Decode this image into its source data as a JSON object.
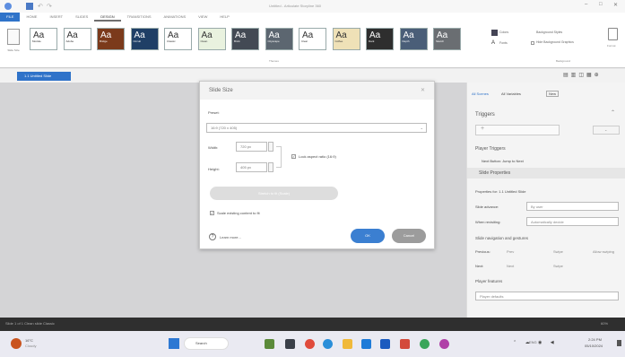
{
  "titlebar": {
    "title": "Untitled - Articulate Storyline 360",
    "close": "✕",
    "minimize": "–",
    "maximize": "□"
  },
  "ribbon": {
    "tabs": [
      "FILE",
      "HOME",
      "INSERT",
      "SLIDES",
      "DESIGN",
      "TRANSITIONS",
      "ANIMATIONS",
      "VIEW",
      "HELP"
    ],
    "themes": [
      {
        "aa": "Aa",
        "label": "Module",
        "bg": "#ffffff",
        "fg": "#333333"
      },
      {
        "aa": "Aa",
        "label": "Adobe",
        "bg": "#ffffff",
        "fg": "#333333"
      },
      {
        "aa": "Aa",
        "label": "Bridge",
        "bg": "#7b3a1b",
        "fg": "#ffffff"
      },
      {
        "aa": "Aa",
        "label": "Circuit",
        "bg": "#1f3f66",
        "fg": "#ffffff"
      },
      {
        "aa": "Aa",
        "label": "Classic",
        "bg": "#ffffff",
        "fg": "#333333"
      },
      {
        "aa": "Aa",
        "label": "Clean",
        "bg": "#e9f2df",
        "fg": "#333333"
      },
      {
        "aa": "Aa",
        "label": "Brick",
        "bg": "#434a54",
        "fg": "#ffffff"
      },
      {
        "aa": "Aa",
        "label": "Cityscape",
        "bg": "#5c6670",
        "fg": "#ffffff"
      },
      {
        "aa": "Aa",
        "label": "Clear",
        "bg": "#ffffff",
        "fg": "#333333"
      },
      {
        "aa": "Aa",
        "label": "Coffee",
        "bg": "#efe1b7",
        "fg": "#333333"
      },
      {
        "aa": "Aa",
        "label": "Dark",
        "bg": "#2e2e2e",
        "fg": "#ffffff"
      },
      {
        "aa": "Aa",
        "label": "Depth",
        "bg": "#4a5e78",
        "fg": "#ffffff"
      },
      {
        "aa": "Aa",
        "label": "Sketch",
        "bg": "#6a6e72",
        "fg": "#ffffff"
      }
    ],
    "themes_group": "Themes",
    "colors": "Colors",
    "fonts": "Fonts",
    "background_styles": "Background Styles",
    "hide_bg": "Hide Background Graphics",
    "slide_size": "Slide Size",
    "background_group": "Background",
    "format": "Format"
  },
  "scene_tab": "1.1 Untitled Slide",
  "dialog": {
    "title": "Slide Size",
    "preset_label": "Preset:",
    "preset_value": "16:9 (720 x 405)",
    "width_label": "Width:",
    "width_value": "720 px",
    "height_label": "Height:",
    "height_value": "405 px",
    "lock_ratio": "Lock aspect ratio (16:9)",
    "stretch_label": "Stretch to fit (Scale)",
    "scale_label": "Scale existing content to fit",
    "learn_more": "Learn more...",
    "ok": "OK",
    "cancel": "Cancel"
  },
  "right_panel": {
    "tab1": "All Scenes",
    "tab2": "All Variables",
    "tab3": "New",
    "triggers_title": "Triggers",
    "player_triggers": "Player Triggers",
    "player_trigger_item": "Next Button: Jump to Next",
    "slide_properties": "Slide Properties",
    "properties_for": "Properties for: 1.1 Untitled Slide",
    "slide_advance_label": "Slide advance:",
    "slide_advance_value": "By user",
    "when_revisiting_label": "When revisiting:",
    "when_revisiting_value": "Automatically decide",
    "nav_gestures": "Slide navigation and gestures",
    "prev_label": "Previous:",
    "next_label": "Next:",
    "allow_swipe": "Allow swiping",
    "player_features": "Player features",
    "player_default": "Player defaults",
    "prev_opt1": "Prev",
    "prev_opt2": "Swipe",
    "next_opt1": "Next",
    "next_opt2": "Swipe"
  },
  "status": {
    "left": "Slide 1 of 1   Clean slide   Classic",
    "zoom": "60%"
  },
  "taskbar": {
    "weather_temp": "16°C",
    "weather_desc": "Cloudy",
    "search": "Search",
    "time": "2:24 PM",
    "date": "05/10/2024",
    "lang": "ENG"
  },
  "colors": {
    "accent": "#2f73c9",
    "ok": "#3b7fd1",
    "cancel": "#9c9c9c"
  }
}
